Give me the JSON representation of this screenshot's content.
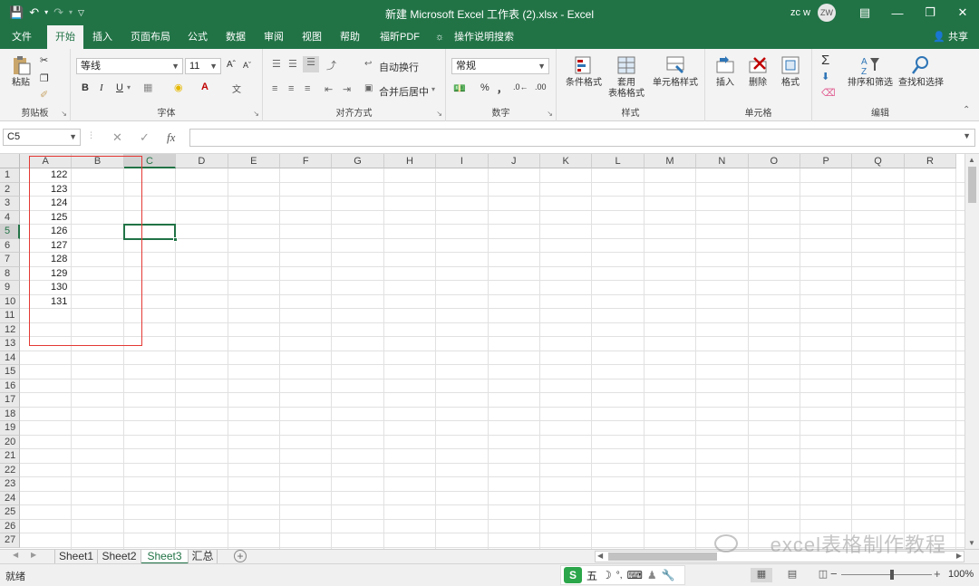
{
  "titlebar": {
    "title": "新建 Microsoft Excel 工作表 (2).xlsx  -  Excel",
    "user": "zc w",
    "avatar": "ZW"
  },
  "tabs": [
    "文件",
    "开始",
    "插入",
    "页面布局",
    "公式",
    "数据",
    "审阅",
    "视图",
    "帮助",
    "福昕PDF",
    "操作说明搜索"
  ],
  "active_tab": "开始",
  "share": "共享",
  "ribbon": {
    "clipboard": {
      "paste": "粘贴",
      "label": "剪贴板"
    },
    "font": {
      "name": "等线",
      "size": "11",
      "bold": "B",
      "italic": "I",
      "underline": "U",
      "label": "字体"
    },
    "alignment": {
      "wrap": "自动换行",
      "merge": "合并后居中",
      "label": "对齐方式"
    },
    "number": {
      "format": "常规",
      "percent": "%",
      "comma": "，",
      "label": "数字"
    },
    "styles": {
      "conditional": "条件格式",
      "table_l1": "套用",
      "table_l2": "表格格式",
      "cell_styles": "单元格样式",
      "label": "样式"
    },
    "cells": {
      "insert": "插入",
      "delete": "删除",
      "format": "格式",
      "label": "单元格"
    },
    "editing": {
      "sort": "排序和筛选",
      "find": "查找和选择",
      "label": "编辑"
    }
  },
  "formula_bar": {
    "name_box": "C5",
    "cancel": "✕",
    "enter": "✓",
    "fx": "fx",
    "value": ""
  },
  "columns": [
    "A",
    "B",
    "C",
    "D",
    "E",
    "F",
    "G",
    "H",
    "I",
    "J",
    "K",
    "L",
    "M",
    "N",
    "O",
    "P",
    "Q",
    "R"
  ],
  "rows": [
    "1",
    "2",
    "3",
    "4",
    "5",
    "6",
    "7",
    "8",
    "9",
    "10",
    "11",
    "12",
    "13",
    "14",
    "15",
    "16",
    "17",
    "18",
    "19",
    "20",
    "21",
    "22",
    "23",
    "24",
    "25",
    "26",
    "27"
  ],
  "cells_A": [
    "122",
    "123",
    "124",
    "125",
    "126",
    "127",
    "128",
    "129",
    "130",
    "131"
  ],
  "selected_cell": "C5",
  "sheets": [
    "Sheet1",
    "Sheet2",
    "Sheet3",
    "汇总"
  ],
  "active_sheet": "Sheet3",
  "status": {
    "ready": "就绪",
    "zoom": "100%",
    "ime_mode": "五"
  },
  "watermark": "excel表格制作教程",
  "colors": {
    "accent": "#217346",
    "highlight_box": "#e53935"
  }
}
